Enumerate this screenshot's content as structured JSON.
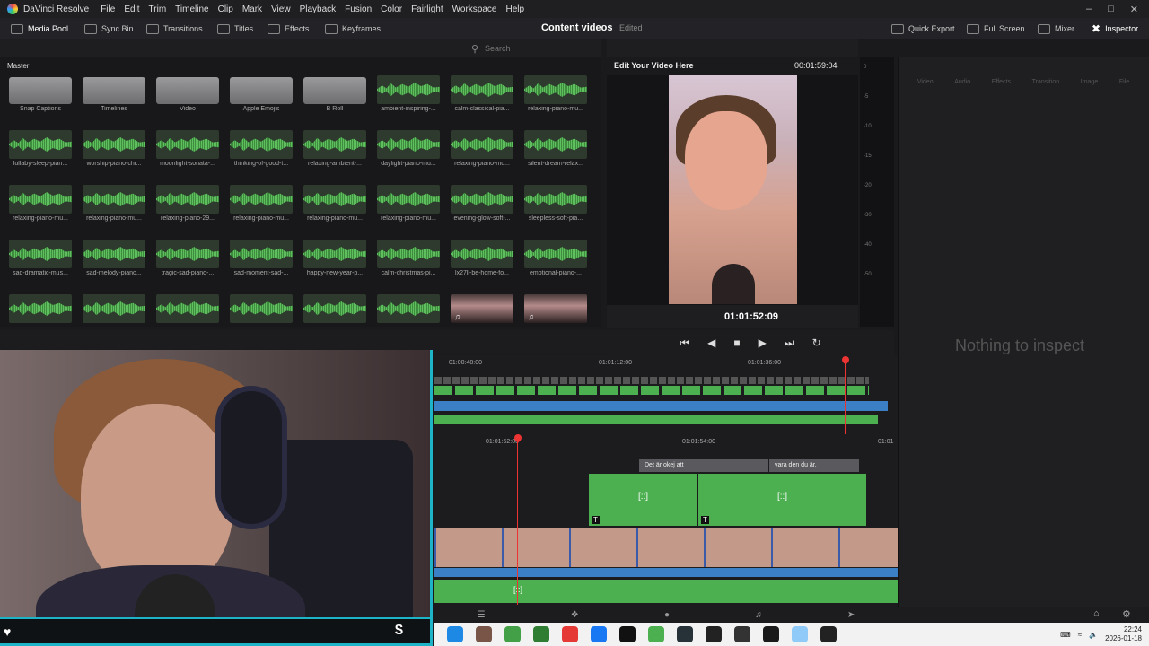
{
  "app": {
    "name": "DaVinci Resolve"
  },
  "menu": [
    "File",
    "Edit",
    "Trim",
    "Timeline",
    "Clip",
    "Mark",
    "View",
    "Playback",
    "Fusion",
    "Color",
    "Fairlight",
    "Workspace",
    "Help"
  ],
  "toolbar": {
    "media_pool": "Media Pool",
    "sync_bin": "Sync Bin",
    "transitions": "Transitions",
    "titles": "Titles",
    "effects": "Effects",
    "keyframes": "Keyframes",
    "project_title": "Content videos",
    "project_status": "Edited",
    "quick_export": "Quick Export",
    "full_screen": "Full Screen",
    "mixer": "Mixer",
    "inspector": "Inspector"
  },
  "media_pool": {
    "search_placeholder": "Search",
    "bin": "Master",
    "clips": [
      {
        "label": "Snap Captions",
        "type": "folder"
      },
      {
        "label": "Timelines",
        "type": "folder"
      },
      {
        "label": "Video",
        "type": "folder"
      },
      {
        "label": "Apple Emojis",
        "type": "folder"
      },
      {
        "label": "B Roll",
        "type": "folder"
      },
      {
        "label": "ambient-inspiring-...",
        "type": "audio"
      },
      {
        "label": "calm-classical-pia...",
        "type": "audio"
      },
      {
        "label": "relaxing-piano-mu...",
        "type": "audio"
      },
      {
        "label": "lullaby-sleep-pian...",
        "type": "audio"
      },
      {
        "label": "worship-piano-chr...",
        "type": "audio"
      },
      {
        "label": "moonlight-sonata-...",
        "type": "audio"
      },
      {
        "label": "thinking-of-good-t...",
        "type": "audio"
      },
      {
        "label": "relaxing-ambient-...",
        "type": "audio"
      },
      {
        "label": "daylight-piano-mu...",
        "type": "audio"
      },
      {
        "label": "relaxing-piano-mu...",
        "type": "audio"
      },
      {
        "label": "silent-dream-relax...",
        "type": "audio"
      },
      {
        "label": "relaxing-piano-mu...",
        "type": "audio"
      },
      {
        "label": "relaxing-piano-mu...",
        "type": "audio"
      },
      {
        "label": "relaxing-piano-29...",
        "type": "audio"
      },
      {
        "label": "relaxing-piano-mu...",
        "type": "audio"
      },
      {
        "label": "relaxing-piano-mu...",
        "type": "audio"
      },
      {
        "label": "relaxing-piano-mu...",
        "type": "audio"
      },
      {
        "label": "evening-glow-soft-...",
        "type": "audio"
      },
      {
        "label": "sleepless-soft-pia...",
        "type": "audio"
      },
      {
        "label": "sad-dramatic-mus...",
        "type": "audio"
      },
      {
        "label": "sad-melody-piano...",
        "type": "audio"
      },
      {
        "label": "tragic-sad-piano-...",
        "type": "audio"
      },
      {
        "label": "sad-moment-sad-...",
        "type": "audio"
      },
      {
        "label": "happy-new-year-p...",
        "type": "audio"
      },
      {
        "label": "calm-christmas-pi...",
        "type": "audio"
      },
      {
        "label": "lx27ll-be-home-fo...",
        "type": "audio"
      },
      {
        "label": "emotional-piano-...",
        "type": "audio"
      },
      {
        "label": "",
        "type": "audio"
      },
      {
        "label": "",
        "type": "audio"
      },
      {
        "label": "",
        "type": "audio"
      },
      {
        "label": "",
        "type": "audio"
      },
      {
        "label": "",
        "type": "audio"
      },
      {
        "label": "",
        "type": "audio"
      },
      {
        "label": "",
        "type": "video"
      },
      {
        "label": "",
        "type": "video"
      }
    ]
  },
  "viewer": {
    "title": "Edit Your Video Here",
    "duration": "00:01:59:04",
    "timecode": "01:01:52:09",
    "meter_marks": [
      "0",
      "-5",
      "-10",
      "-15",
      "-20",
      "-30",
      "-40",
      "-50"
    ]
  },
  "inspector": {
    "tabs": [
      "Video",
      "Audio",
      "Effects",
      "Transition",
      "Image",
      "File"
    ],
    "empty_text": "Nothing to inspect"
  },
  "timeline": {
    "upper_ruler": [
      "01:00:48:00",
      "01:01:12:00",
      "01:01:36:00"
    ],
    "lower_ruler": [
      "01:01:52:00",
      "01:01:54:00",
      "01:01"
    ],
    "subtitles": [
      "Det är okej att",
      "vara den du är."
    ],
    "title_marker": "[::]"
  },
  "taskbar": {
    "time": "22:24",
    "date": "2026-01-18"
  }
}
